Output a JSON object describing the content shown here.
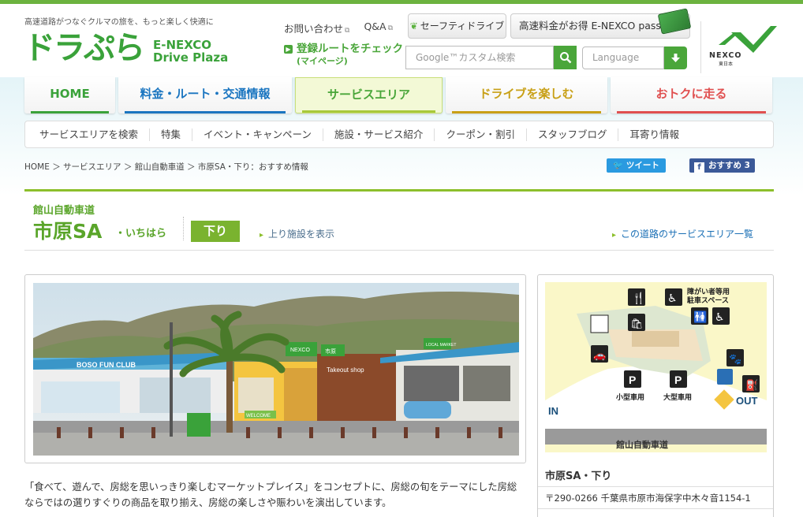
{
  "header": {
    "tagline": "高速道路がつなぐクルマの旅を、もっと楽しく快適に",
    "logo_jp": "ドラぷら",
    "logo_en_line1": "E-NEXCO",
    "logo_en_line2": "Drive Plaza",
    "contact": "お問い合わせ",
    "qa": "Q&A",
    "route_check": "登録ルートをチェック",
    "route_check_sub": "(マイページ)",
    "safety_drive": "セーフティドライブ",
    "pass_button": "高速料金がお得 E-NEXCO pass",
    "search_placeholder": "Google™カスタム検索",
    "language": "Language",
    "nexco": "NEXCO",
    "nexco_sub": "東日本"
  },
  "global_nav": [
    "HOME",
    "料金・ルート・交通情報",
    "サービスエリア",
    "ドライブを楽しむ",
    "おトクに走る"
  ],
  "sub_nav": [
    "サービスエリアを検索",
    "特集",
    "イベント・キャンペーン",
    "施設・サービス紹介",
    "クーポン・割引",
    "スタッフブログ",
    "耳寄り情報"
  ],
  "breadcrumb": "HOME ＞ サービスエリア ＞ 館山自動車道 ＞ 市原SA・下り：おすすめ情報",
  "social": {
    "tweet": "ツイート",
    "fb_like": "おすすめ",
    "fb_count": "3"
  },
  "title": {
    "road": "館山自動車道",
    "name": "市原SA",
    "kana": "・いちはら",
    "direction": "下り",
    "up_link": "上り施設を表示",
    "road_list": "この道路のサービスエリア一覧"
  },
  "photo": {
    "shop_label_1": "BOSO FUN CLUB",
    "shop_label_2": "Takeout shop",
    "sign_1": "NEXCO",
    "sign_2": "市原",
    "sign_3": "LOCAL MARKET",
    "sign_4": "WELCOME"
  },
  "description": "「食べて、遊んで、房総を思いっきり楽しむマーケットプレイス」をコンセプトに、房総の旬をテーマにした房総ならではの選りすぐりの商品を取り揃え、房総の楽しさや賑わいを演出しています。",
  "map": {
    "disabled_parking": "障がい者等用\n駐車スペース",
    "small_car": "小型車用",
    "large_car": "大型車用",
    "in": "IN",
    "out": "OUT",
    "road_label": "館山自動車道",
    "sa_name": "市原SA・下り",
    "address": "〒290-0266 千葉県市原市海保字中木々音1154-1"
  },
  "colors": {
    "brand_green": "#3aa23a",
    "accent_lime": "#8cbf2b",
    "link_blue": "#1a6fb5"
  }
}
